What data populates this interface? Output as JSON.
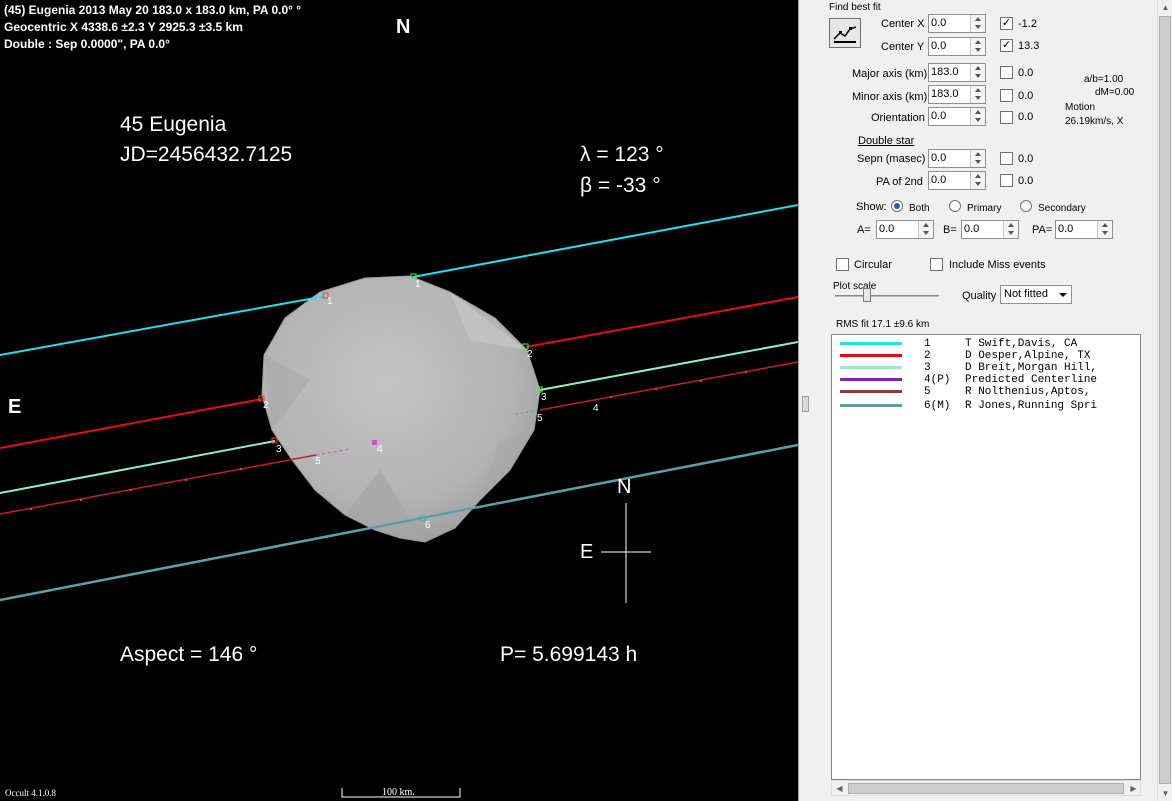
{
  "plot": {
    "header_lines": [
      "(45) Eugenia  2013 May 20   183.0 x 183.0 km,  PA 0.0° °",
      "Geocentric  X  4338.6 ±2.3   Y 2925.3 ±3.5 km",
      "Double : Sep  0.0000\", PA 0.0°"
    ],
    "north_top": "N",
    "east_left": "E",
    "object_name": "45 Eugenia",
    "jd": "JD=2456432.7125",
    "lambda": "λ =  123 °",
    "beta": "β =  -33 °",
    "aspect": "Aspect = 146 °",
    "period": "P= 5.699143 h",
    "compass_n": "N",
    "compass_e": "E",
    "version": "Occult 4.1.0.8",
    "scale_label": "100 km.",
    "chord_labels": [
      "1",
      "1",
      "2",
      "2",
      "3",
      "3",
      "4",
      "4",
      "5",
      "5",
      "6"
    ]
  },
  "panel": {
    "find_best_fit": "Find best fit",
    "center_x": {
      "label": "Center X",
      "value": "0.0",
      "checked": true,
      "result": "-1.2"
    },
    "center_y": {
      "label": "Center Y",
      "value": "0.0",
      "checked": true,
      "result": "13.3"
    },
    "major_axis": {
      "label": "Major axis (km)",
      "value": "183.0",
      "result": "0.0"
    },
    "minor_axis": {
      "label": "Minor axis (km)",
      "value": "183.0",
      "result": "0.0"
    },
    "orientation": {
      "label": "Orientation",
      "value": "0.0",
      "result": "0.0"
    },
    "ab_ratio": "a/b=1.00",
    "dm": "dM=0.00",
    "motion_label": "Motion",
    "motion_value": "26.19km/s, X",
    "double_star": "Double star",
    "sepn": {
      "label": "Sepn (masec)",
      "value": "0.0",
      "result": "0.0"
    },
    "pa2nd": {
      "label": "PA of 2nd",
      "value": "0.0",
      "result": "0.0"
    },
    "show_label": "Show:",
    "show_both": "Both",
    "show_primary": "Primary",
    "show_secondary": "Secondary",
    "a_label": "A=",
    "a_value": "0.0",
    "b_label": "B=",
    "b_value": "0.0",
    "pa_label": "PA=",
    "pa_value": "0.0",
    "circular": "Circular",
    "include_miss": "Include Miss events",
    "plot_scale": "Plot scale",
    "quality_label": "Quality",
    "quality_value": "Not fitted",
    "rms_fit": "RMS fit 17.1 ±9.6 km"
  },
  "observers": [
    {
      "num": "1",
      "name": "T Swift,Davis, CA",
      "color": "#22e0f0"
    },
    {
      "num": "2",
      "name": "D Oesper,Alpine, TX",
      "color": "#e01010"
    },
    {
      "num": "3",
      "name": "D Breit,Morgan Hill,",
      "color": "#90f0c0"
    },
    {
      "num": "4(P)",
      "name": "Predicted Centerline",
      "color": "#8020c0"
    },
    {
      "num": "5",
      "name": "R Nolthenius,Aptos,",
      "color": "#a03040"
    },
    {
      "num": "6(M)",
      "name": "R Jones,Running Spri",
      "color": "#5aa0a8"
    }
  ],
  "colors": {
    "chord1": "#22e0f0",
    "chord2": "#e01010",
    "chord3": "#90f0c0",
    "chord4": "#c850c8",
    "chord5": "#c02030",
    "chord6": "#5aa0a8",
    "asteroid": "#bdbdbd"
  }
}
